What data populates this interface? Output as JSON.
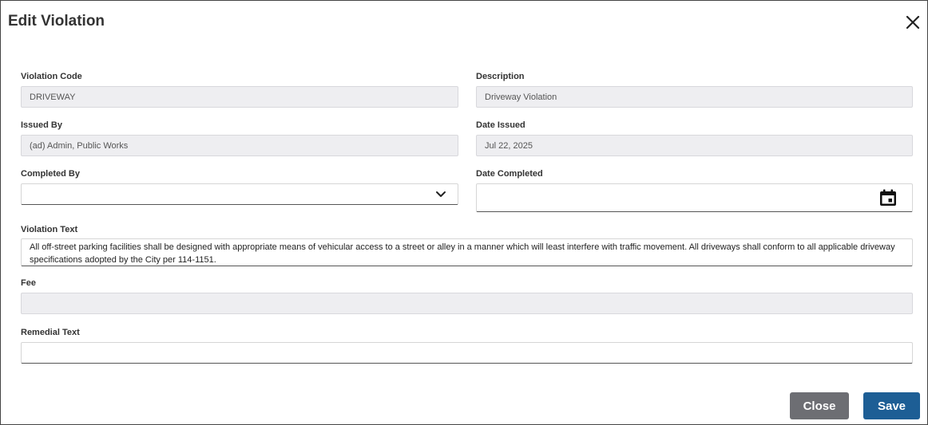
{
  "dialog": {
    "title": "Edit Violation"
  },
  "icons": {
    "close": "close-icon",
    "dropdown": "chevron-down-icon",
    "calendar": "calendar-icon"
  },
  "form": {
    "violation_code": {
      "label": "Violation Code",
      "value": "DRIVEWAY"
    },
    "description": {
      "label": "Description",
      "value": "Driveway Violation"
    },
    "issued_by": {
      "label": "Issued By",
      "value": "(ad) Admin, Public Works"
    },
    "date_issued": {
      "label": "Date Issued",
      "value": "Jul 22, 2025"
    },
    "completed_by": {
      "label": "Completed By",
      "value": ""
    },
    "date_completed": {
      "label": "Date Completed",
      "value": ""
    },
    "violation_text": {
      "label": "Violation Text",
      "value": "All off-street parking facilities shall be designed with appropriate means of vehicular access to a street or alley in a manner which will least interfere with traffic movement.  All driveways shall conform to all applicable driveway specifications adopted by the City per 114-1151."
    },
    "fee": {
      "label": "Fee",
      "value": ""
    },
    "remedial_text": {
      "label": "Remedial Text",
      "value": ""
    }
  },
  "actions": {
    "close_label": "Close",
    "save_label": "Save"
  },
  "colors": {
    "save_button": "#1d5e95",
    "close_button": "#6d6e73",
    "readonly_field": "#eeeef1"
  }
}
